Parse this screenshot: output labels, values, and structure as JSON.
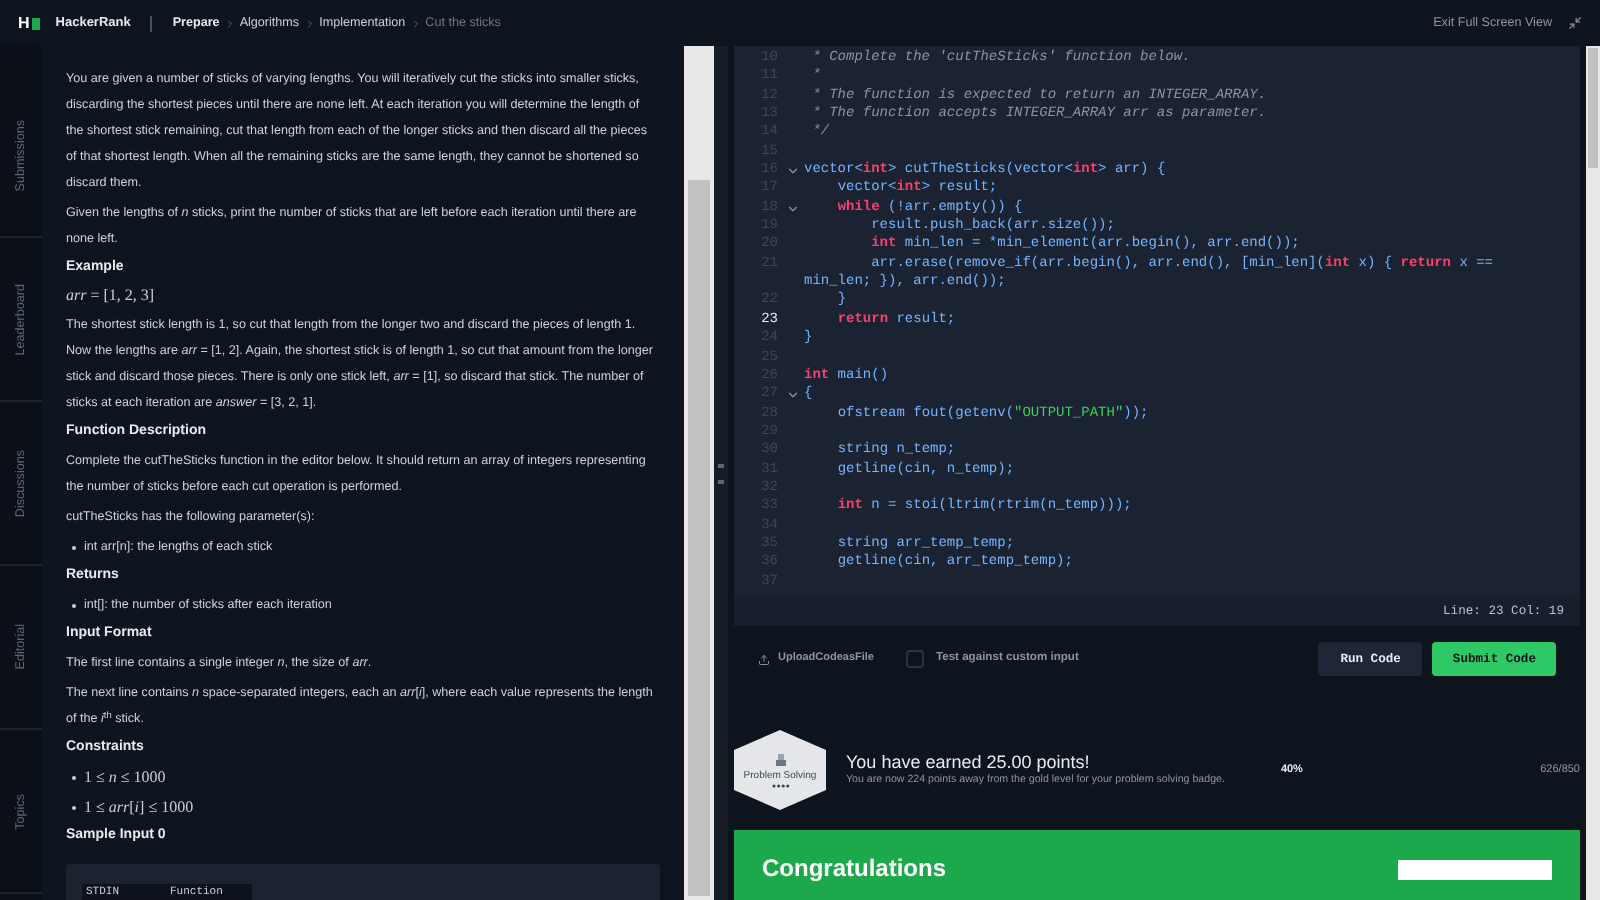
{
  "header": {
    "logo": "H",
    "brand": "HackerRank",
    "breadcrumbs": [
      {
        "label": "Prepare",
        "current": false
      },
      {
        "label": "Algorithms",
        "current": false
      },
      {
        "label": "Implementation",
        "current": false
      },
      {
        "label": "Cut the sticks",
        "current": true
      }
    ],
    "exit_button": "Exit Full Screen View"
  },
  "side_tabs": [
    "Submissions",
    "Leaderboard",
    "Discussions",
    "Editorial",
    "Topics"
  ],
  "problem": [
    {
      "kind": "p",
      "text": "You are given a number of sticks of varying lengths. You will iteratively cut the sticks into smaller sticks, discarding the shortest pieces until there are none left. At each iteration you will determine the length of the shortest stick remaining, cut that length from each of the longer sticks and then discard all the pieces of that shortest length. When all the remaining sticks are the same length, they cannot be shortened so discard them."
    },
    {
      "kind": "p",
      "text": "Given the lengths of *n* sticks, print the number of sticks that are left before each iteration until there are none left."
    },
    {
      "kind": "heading",
      "text": "Example"
    },
    {
      "kind": "math",
      "text": "*arr* = [1, 2, 3]"
    },
    {
      "kind": "p",
      "text": "The shortest stick length is 1, so cut that length from the longer two and discard the pieces of length 1. Now the lengths are *arr* = [1, 2]. Again, the shortest stick is of length 1, so cut that amount from the longer stick and discard those pieces. There is only one stick left, *arr* = [1], so discard that stick. The number of sticks at each iteration are *answer* = [3, 2, 1]."
    },
    {
      "kind": "heading",
      "text": "Function Description"
    },
    {
      "kind": "p",
      "text": "Complete the cutTheSticks function in the editor below. It should return an array of integers representing the number of sticks before each cut operation is performed."
    },
    {
      "kind": "p",
      "text": "cutTheSticks has the following parameter(s):"
    },
    {
      "kind": "bullet",
      "text": "int arr[n]: the lengths of each stick"
    },
    {
      "kind": "heading",
      "text": "Returns"
    },
    {
      "kind": "bullet",
      "text": "int[]: the number of sticks after each iteration"
    },
    {
      "kind": "heading",
      "text": "Input Format"
    },
    {
      "kind": "p",
      "text": "The first line contains a single integer *n*, the size of *arr*."
    },
    {
      "kind": "p",
      "text": "The next line contains *n* space-separated integers, each an *arr*[*i*], where each value represents the length of the *i*$^{th}$ stick."
    },
    {
      "kind": "heading",
      "text": "Constraints"
    },
    {
      "kind": "mathbullet",
      "text": "1 ≤ *n* ≤ 1000"
    },
    {
      "kind": "mathbullet",
      "text": "1 ≤ *arr*[*i*] ≤ 1000"
    },
    {
      "kind": "heading",
      "text": "Sample Input 0"
    },
    {
      "kind": "sample",
      "cells": [
        "STDIN",
        "Function"
      ]
    }
  ],
  "editor": {
    "lines": [
      {
        "number": "10",
        "fold": false,
        "active": false,
        "tokens": [
          {
            "kind": "comment",
            "text": " * Complete the 'cutTheSticks' function below."
          }
        ]
      },
      {
        "number": "11",
        "fold": false,
        "active": false,
        "tokens": [
          {
            "kind": "comment",
            "text": " *"
          }
        ]
      },
      {
        "number": "12",
        "fold": false,
        "active": false,
        "tokens": [
          {
            "kind": "comment",
            "text": " * The function is expected to return an INTEGER_ARRAY."
          }
        ]
      },
      {
        "number": "13",
        "fold": false,
        "active": false,
        "tokens": [
          {
            "kind": "comment",
            "text": " * The function accepts INTEGER_ARRAY arr as parameter."
          }
        ]
      },
      {
        "number": "14",
        "fold": false,
        "active": false,
        "tokens": [
          {
            "kind": "comment",
            "text": " */"
          }
        ]
      },
      {
        "number": "15",
        "fold": false,
        "active": false
      },
      {
        "number": "16",
        "fold": true,
        "active": false,
        "tokens": [
          {
            "kind": "plain",
            "text": "vector<"
          },
          {
            "kind": "keyword",
            "text": "int"
          },
          {
            "kind": "plain",
            "text": "> cutTheSticks(vector<"
          },
          {
            "kind": "keyword",
            "text": "int"
          },
          {
            "kind": "plain",
            "text": "> arr) {"
          }
        ]
      },
      {
        "number": "17",
        "fold": false,
        "active": false,
        "tokens": [
          {
            "kind": "plain",
            "text": "    vector<"
          },
          {
            "kind": "keyword",
            "text": "int"
          },
          {
            "kind": "plain",
            "text": "> result;"
          }
        ]
      },
      {
        "number": "18",
        "fold": true,
        "active": false,
        "tokens": [
          {
            "kind": "keyword",
            "text": "    while"
          },
          {
            "kind": "plain",
            "text": " (!arr.empty()) {"
          }
        ]
      },
      {
        "number": "19",
        "fold": false,
        "active": false,
        "tokens": [
          {
            "kind": "plain",
            "text": "        result.push_back(arr.size());"
          }
        ]
      },
      {
        "number": "20",
        "fold": false,
        "active": false,
        "tokens": [
          {
            "kind": "keyword",
            "text": "        int"
          },
          {
            "kind": "plain",
            "text": " min_len = *min_element(arr.begin(), arr.end());"
          }
        ]
      },
      {
        "number": "21",
        "fold": false,
        "active": false,
        "tokens": [
          {
            "kind": "plain",
            "text": "        arr.erase(remove_if(arr.begin(), arr.end(), [min_len]("
          },
          {
            "kind": "keyword",
            "text": "int"
          },
          {
            "kind": "plain",
            "text": " x) { "
          },
          {
            "kind": "keyword",
            "text": "return"
          },
          {
            "kind": "plain",
            "text": " x == min_len; }), arr.end());"
          }
        ]
      },
      {
        "number": "22",
        "fold": false,
        "active": false,
        "tokens": [
          {
            "kind": "plain",
            "text": "    }"
          }
        ]
      },
      {
        "number": "23",
        "fold": false,
        "active": true,
        "tokens": [
          {
            "kind": "keyword",
            "text": "    return"
          },
          {
            "kind": "plain",
            "text": " result;"
          }
        ]
      },
      {
        "number": "24",
        "fold": false,
        "active": false,
        "tokens": [
          {
            "kind": "plain",
            "text": "}"
          }
        ]
      },
      {
        "number": "25",
        "fold": false,
        "active": false
      },
      {
        "number": "26",
        "fold": false,
        "active": false,
        "tokens": [
          {
            "kind": "keyword",
            "text": "int"
          },
          {
            "kind": "plain",
            "text": " main()"
          }
        ]
      },
      {
        "number": "27",
        "fold": true,
        "active": false,
        "tokens": [
          {
            "kind": "plain",
            "text": "{"
          }
        ]
      },
      {
        "number": "28",
        "fold": false,
        "active": false,
        "tokens": [
          {
            "kind": "plain",
            "text": "    ofstream fout(getenv("
          },
          {
            "kind": "string",
            "text": "\"OUTPUT_PATH\""
          },
          {
            "kind": "plain",
            "text": "));"
          }
        ]
      },
      {
        "number": "29",
        "fold": false,
        "active": false
      },
      {
        "number": "30",
        "fold": false,
        "active": false,
        "tokens": [
          {
            "kind": "plain",
            "text": "    string n_temp;"
          }
        ]
      },
      {
        "number": "31",
        "fold": false,
        "active": false,
        "tokens": [
          {
            "kind": "plain",
            "text": "    getline(cin, n_temp);"
          }
        ]
      },
      {
        "number": "32",
        "fold": false,
        "active": false
      },
      {
        "number": "33",
        "fold": false,
        "active": false,
        "tokens": [
          {
            "kind": "keyword",
            "text": "    int"
          },
          {
            "kind": "plain",
            "text": " n = stoi(ltrim(rtrim(n_temp)));"
          }
        ]
      },
      {
        "number": "34",
        "fold": false,
        "active": false
      },
      {
        "number": "35",
        "fold": false,
        "active": false,
        "tokens": [
          {
            "kind": "plain",
            "text": "    string arr_temp_temp;"
          }
        ]
      },
      {
        "number": "36",
        "fold": false,
        "active": false,
        "tokens": [
          {
            "kind": "plain",
            "text": "    getline(cin, arr_temp_temp);"
          }
        ]
      },
      {
        "number": "37",
        "fold": false,
        "active": false
      }
    ],
    "status": "Line: 23 Col: 19"
  },
  "actions": {
    "upload": "UploadCodeasFile",
    "custom_input": {
      "label": "Test against custom input",
      "checked": false
    },
    "run": "Run Code",
    "submit": "Submit Code"
  },
  "achievement": {
    "badge_label": "Problem Solving",
    "headline": "You have earned 25.00 points!",
    "detail": "You are now 224 points away from the gold level for your problem solving badge.",
    "percent": "40%",
    "score": "626/850"
  },
  "banner": {
    "title": "Congratulations"
  }
}
